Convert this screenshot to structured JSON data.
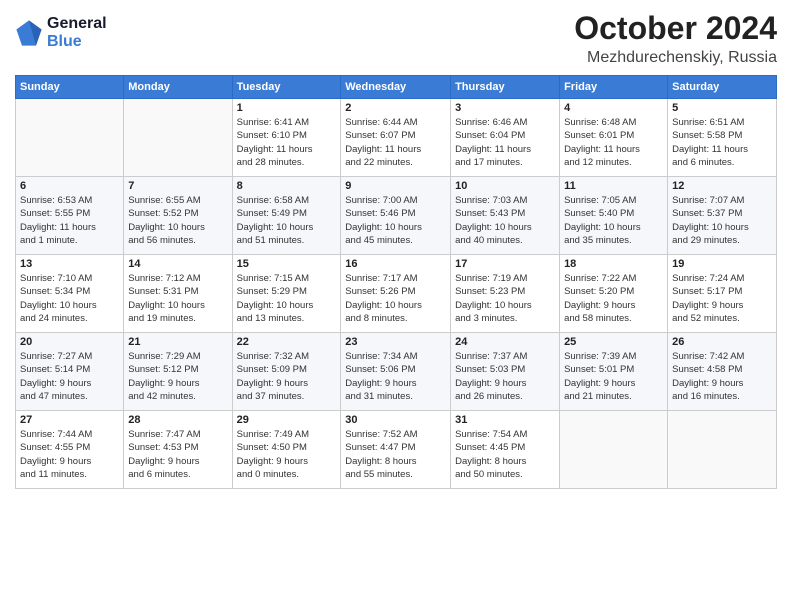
{
  "header": {
    "logo_line1": "General",
    "logo_line2": "Blue",
    "month": "October 2024",
    "location": "Mezhdurechenskiy, Russia"
  },
  "days_of_week": [
    "Sunday",
    "Monday",
    "Tuesday",
    "Wednesday",
    "Thursday",
    "Friday",
    "Saturday"
  ],
  "weeks": [
    [
      {
        "day": "",
        "info": ""
      },
      {
        "day": "",
        "info": ""
      },
      {
        "day": "1",
        "info": "Sunrise: 6:41 AM\nSunset: 6:10 PM\nDaylight: 11 hours\nand 28 minutes."
      },
      {
        "day": "2",
        "info": "Sunrise: 6:44 AM\nSunset: 6:07 PM\nDaylight: 11 hours\nand 22 minutes."
      },
      {
        "day": "3",
        "info": "Sunrise: 6:46 AM\nSunset: 6:04 PM\nDaylight: 11 hours\nand 17 minutes."
      },
      {
        "day": "4",
        "info": "Sunrise: 6:48 AM\nSunset: 6:01 PM\nDaylight: 11 hours\nand 12 minutes."
      },
      {
        "day": "5",
        "info": "Sunrise: 6:51 AM\nSunset: 5:58 PM\nDaylight: 11 hours\nand 6 minutes."
      }
    ],
    [
      {
        "day": "6",
        "info": "Sunrise: 6:53 AM\nSunset: 5:55 PM\nDaylight: 11 hours\nand 1 minute."
      },
      {
        "day": "7",
        "info": "Sunrise: 6:55 AM\nSunset: 5:52 PM\nDaylight: 10 hours\nand 56 minutes."
      },
      {
        "day": "8",
        "info": "Sunrise: 6:58 AM\nSunset: 5:49 PM\nDaylight: 10 hours\nand 51 minutes."
      },
      {
        "day": "9",
        "info": "Sunrise: 7:00 AM\nSunset: 5:46 PM\nDaylight: 10 hours\nand 45 minutes."
      },
      {
        "day": "10",
        "info": "Sunrise: 7:03 AM\nSunset: 5:43 PM\nDaylight: 10 hours\nand 40 minutes."
      },
      {
        "day": "11",
        "info": "Sunrise: 7:05 AM\nSunset: 5:40 PM\nDaylight: 10 hours\nand 35 minutes."
      },
      {
        "day": "12",
        "info": "Sunrise: 7:07 AM\nSunset: 5:37 PM\nDaylight: 10 hours\nand 29 minutes."
      }
    ],
    [
      {
        "day": "13",
        "info": "Sunrise: 7:10 AM\nSunset: 5:34 PM\nDaylight: 10 hours\nand 24 minutes."
      },
      {
        "day": "14",
        "info": "Sunrise: 7:12 AM\nSunset: 5:31 PM\nDaylight: 10 hours\nand 19 minutes."
      },
      {
        "day": "15",
        "info": "Sunrise: 7:15 AM\nSunset: 5:29 PM\nDaylight: 10 hours\nand 13 minutes."
      },
      {
        "day": "16",
        "info": "Sunrise: 7:17 AM\nSunset: 5:26 PM\nDaylight: 10 hours\nand 8 minutes."
      },
      {
        "day": "17",
        "info": "Sunrise: 7:19 AM\nSunset: 5:23 PM\nDaylight: 10 hours\nand 3 minutes."
      },
      {
        "day": "18",
        "info": "Sunrise: 7:22 AM\nSunset: 5:20 PM\nDaylight: 9 hours\nand 58 minutes."
      },
      {
        "day": "19",
        "info": "Sunrise: 7:24 AM\nSunset: 5:17 PM\nDaylight: 9 hours\nand 52 minutes."
      }
    ],
    [
      {
        "day": "20",
        "info": "Sunrise: 7:27 AM\nSunset: 5:14 PM\nDaylight: 9 hours\nand 47 minutes."
      },
      {
        "day": "21",
        "info": "Sunrise: 7:29 AM\nSunset: 5:12 PM\nDaylight: 9 hours\nand 42 minutes."
      },
      {
        "day": "22",
        "info": "Sunrise: 7:32 AM\nSunset: 5:09 PM\nDaylight: 9 hours\nand 37 minutes."
      },
      {
        "day": "23",
        "info": "Sunrise: 7:34 AM\nSunset: 5:06 PM\nDaylight: 9 hours\nand 31 minutes."
      },
      {
        "day": "24",
        "info": "Sunrise: 7:37 AM\nSunset: 5:03 PM\nDaylight: 9 hours\nand 26 minutes."
      },
      {
        "day": "25",
        "info": "Sunrise: 7:39 AM\nSunset: 5:01 PM\nDaylight: 9 hours\nand 21 minutes."
      },
      {
        "day": "26",
        "info": "Sunrise: 7:42 AM\nSunset: 4:58 PM\nDaylight: 9 hours\nand 16 minutes."
      }
    ],
    [
      {
        "day": "27",
        "info": "Sunrise: 7:44 AM\nSunset: 4:55 PM\nDaylight: 9 hours\nand 11 minutes."
      },
      {
        "day": "28",
        "info": "Sunrise: 7:47 AM\nSunset: 4:53 PM\nDaylight: 9 hours\nand 6 minutes."
      },
      {
        "day": "29",
        "info": "Sunrise: 7:49 AM\nSunset: 4:50 PM\nDaylight: 9 hours\nand 0 minutes."
      },
      {
        "day": "30",
        "info": "Sunrise: 7:52 AM\nSunset: 4:47 PM\nDaylight: 8 hours\nand 55 minutes."
      },
      {
        "day": "31",
        "info": "Sunrise: 7:54 AM\nSunset: 4:45 PM\nDaylight: 8 hours\nand 50 minutes."
      },
      {
        "day": "",
        "info": ""
      },
      {
        "day": "",
        "info": ""
      }
    ]
  ]
}
